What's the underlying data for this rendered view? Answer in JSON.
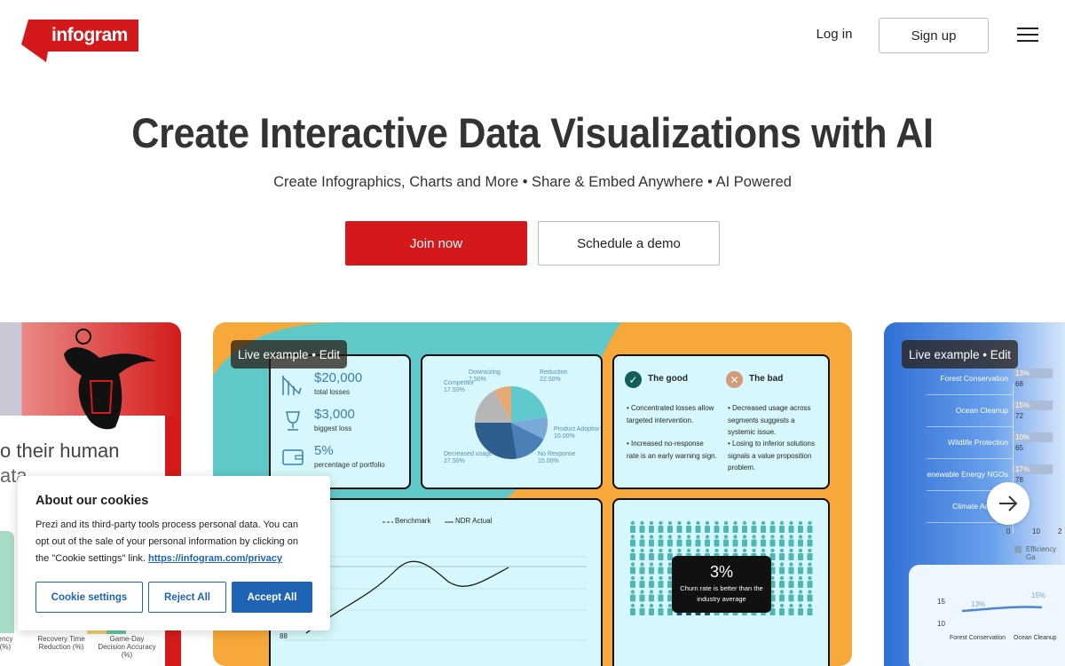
{
  "header": {
    "logo_text": "infogram",
    "login_label": "Log in",
    "signup_label": "Sign up",
    "colors": {
      "brand_red": "#d3191c",
      "primary_blue": "#1f63b5"
    }
  },
  "hero": {
    "title": "Create Interactive Data Visualizations with AI",
    "subtitle": "Create Infographics, Charts and More • Share & Embed Anywhere • AI Powered",
    "join_label": "Join now",
    "demo_label": "Schedule a demo"
  },
  "carousel": {
    "left_card": {
      "text_line1": "o their human",
      "text_line2": "ata",
      "labels": [
        "ency\n(%)",
        "Recovery Time\nReduction (%)",
        "Game-Day Decision\nAccuracy (%)"
      ]
    },
    "main_card": {
      "tag": "Live example • Edit",
      "stats": [
        {
          "value": "$20,000",
          "label": "total losses"
        },
        {
          "value": "$3,000",
          "label": "biggest loss"
        },
        {
          "value": "5%",
          "label": "percentage of portfolio"
        }
      ],
      "pie": {
        "slices": [
          {
            "label": "Downsizing",
            "pct": "7.50%",
            "value": 7.5,
            "color": "#e8a872"
          },
          {
            "label": "Reduction",
            "pct": "22.50%",
            "value": 22.5,
            "color": "#5ec8cc"
          },
          {
            "label": "Product Adoption",
            "pct": "10.00%",
            "value": 10,
            "color": "#7aa8d8"
          },
          {
            "label": "No Response",
            "pct": "15.00%",
            "value": 15,
            "color": "#4b7fb5"
          },
          {
            "label": "Decreased usage",
            "pct": "27.50%",
            "value": 27.5,
            "color": "#2f5e8e"
          },
          {
            "label": "Competitor",
            "pct": "17.50%",
            "value": 17.5,
            "color": "#b6b6b6"
          }
        ]
      },
      "good_title": "The good",
      "bad_title": "The bad",
      "good_points": [
        "Concentrated losses allow targeted intervention.",
        "Increased no-response rate is an early warning sign."
      ],
      "bad_points": [
        "Decreased usage across segments suggests a systemic issue.",
        "Losing to inferior solutions signals a value proposition problem."
      ],
      "line_legend": [
        "Benchmark",
        "NDR Actual"
      ],
      "line_y_label": "88",
      "churn_value": "3%",
      "churn_text": "Churn rate is better than the industry average"
    },
    "right_card": {
      "tag": "Live example • Edit",
      "rows": [
        {
          "name": "Forest Conservation",
          "pct": "13%",
          "val": "68"
        },
        {
          "name": "Ocean Cleanup",
          "pct": "15%",
          "val": "72"
        },
        {
          "name": "Wildlife Protection",
          "pct": "10%",
          "val": "65"
        },
        {
          "name": "enewable Energy NGOs",
          "pct": "17%",
          "val": "78"
        },
        {
          "name": "Climate Action C",
          "pct": "",
          "val": ""
        }
      ],
      "axis_ticks": [
        "0",
        "10",
        "2"
      ],
      "legend_label": "Efficiency Ga",
      "mini_ticks": [
        "15",
        "10"
      ],
      "mini_labels": [
        "Forest Conservation",
        "Ocean Cleanup"
      ],
      "mini_points": [
        "13%",
        "15%"
      ]
    }
  },
  "cookie": {
    "title": "About our cookies",
    "body": "Prezi and its third-party tools process personal data. You can opt out of the sale of your personal information by clicking on the \"Cookie settings\" link.",
    "link": "https://infogram.com/privacy",
    "settings_label": "Cookie settings",
    "reject_label": "Reject All",
    "accept_label": "Accept All"
  }
}
